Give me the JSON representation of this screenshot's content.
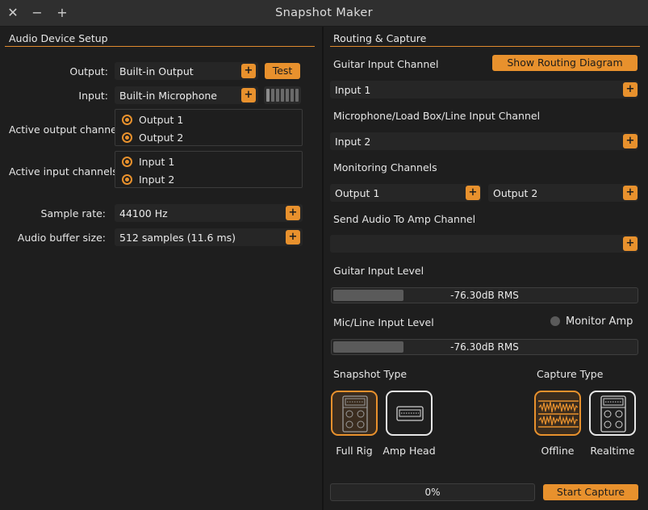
{
  "window": {
    "title": "Snapshot Maker"
  },
  "audio_setup": {
    "title": "Audio Device Setup",
    "output_label": "Output:",
    "output_value": "Built-in Output",
    "test_label": "Test",
    "input_label": "Input:",
    "input_value": "Built-in Microphone",
    "active_output_label": "Active output channels:",
    "output_channels": [
      "Output 1",
      "Output 2"
    ],
    "active_input_label": "Active input channels:",
    "input_channels": [
      "Input 1",
      "Input 2"
    ],
    "sample_rate_label": "Sample rate:",
    "sample_rate_value": "44100 Hz",
    "buffer_label": "Audio buffer size:",
    "buffer_value": "512 samples (11.6 ms)"
  },
  "routing": {
    "title": "Routing & Capture",
    "guitar_input_label": "Guitar Input Channel",
    "show_routing_label": "Show Routing Diagram",
    "guitar_input_value": "Input 1",
    "mic_input_label": "Microphone/Load Box/Line Input Channel",
    "mic_input_value": "Input 2",
    "monitoring_label": "Monitoring Channels",
    "monitor_left_value": "Output 1",
    "monitor_right_value": "Output 2",
    "send_audio_label": "Send Audio To Amp Channel",
    "send_audio_value": "",
    "guitar_level_label": "Guitar Input Level",
    "guitar_level_value": "-76.30dB RMS",
    "guitar_level_fraction": 0.23,
    "mic_level_label": "Mic/Line Input Level",
    "monitor_amp_label": "Monitor Amp",
    "mic_level_value": "-76.30dB RMS",
    "mic_level_fraction": 0.23,
    "snapshot_type_label": "Snapshot Type",
    "snapshot_types": [
      "Full Rig",
      "Amp Head"
    ],
    "capture_type_label": "Capture Type",
    "capture_types": [
      "Offline",
      "Realtime"
    ],
    "progress_value": "0%",
    "start_capture_label": "Start Capture"
  },
  "colors": {
    "accent": "#e8912d",
    "background": "#1e1e1e",
    "field": "#262626"
  }
}
